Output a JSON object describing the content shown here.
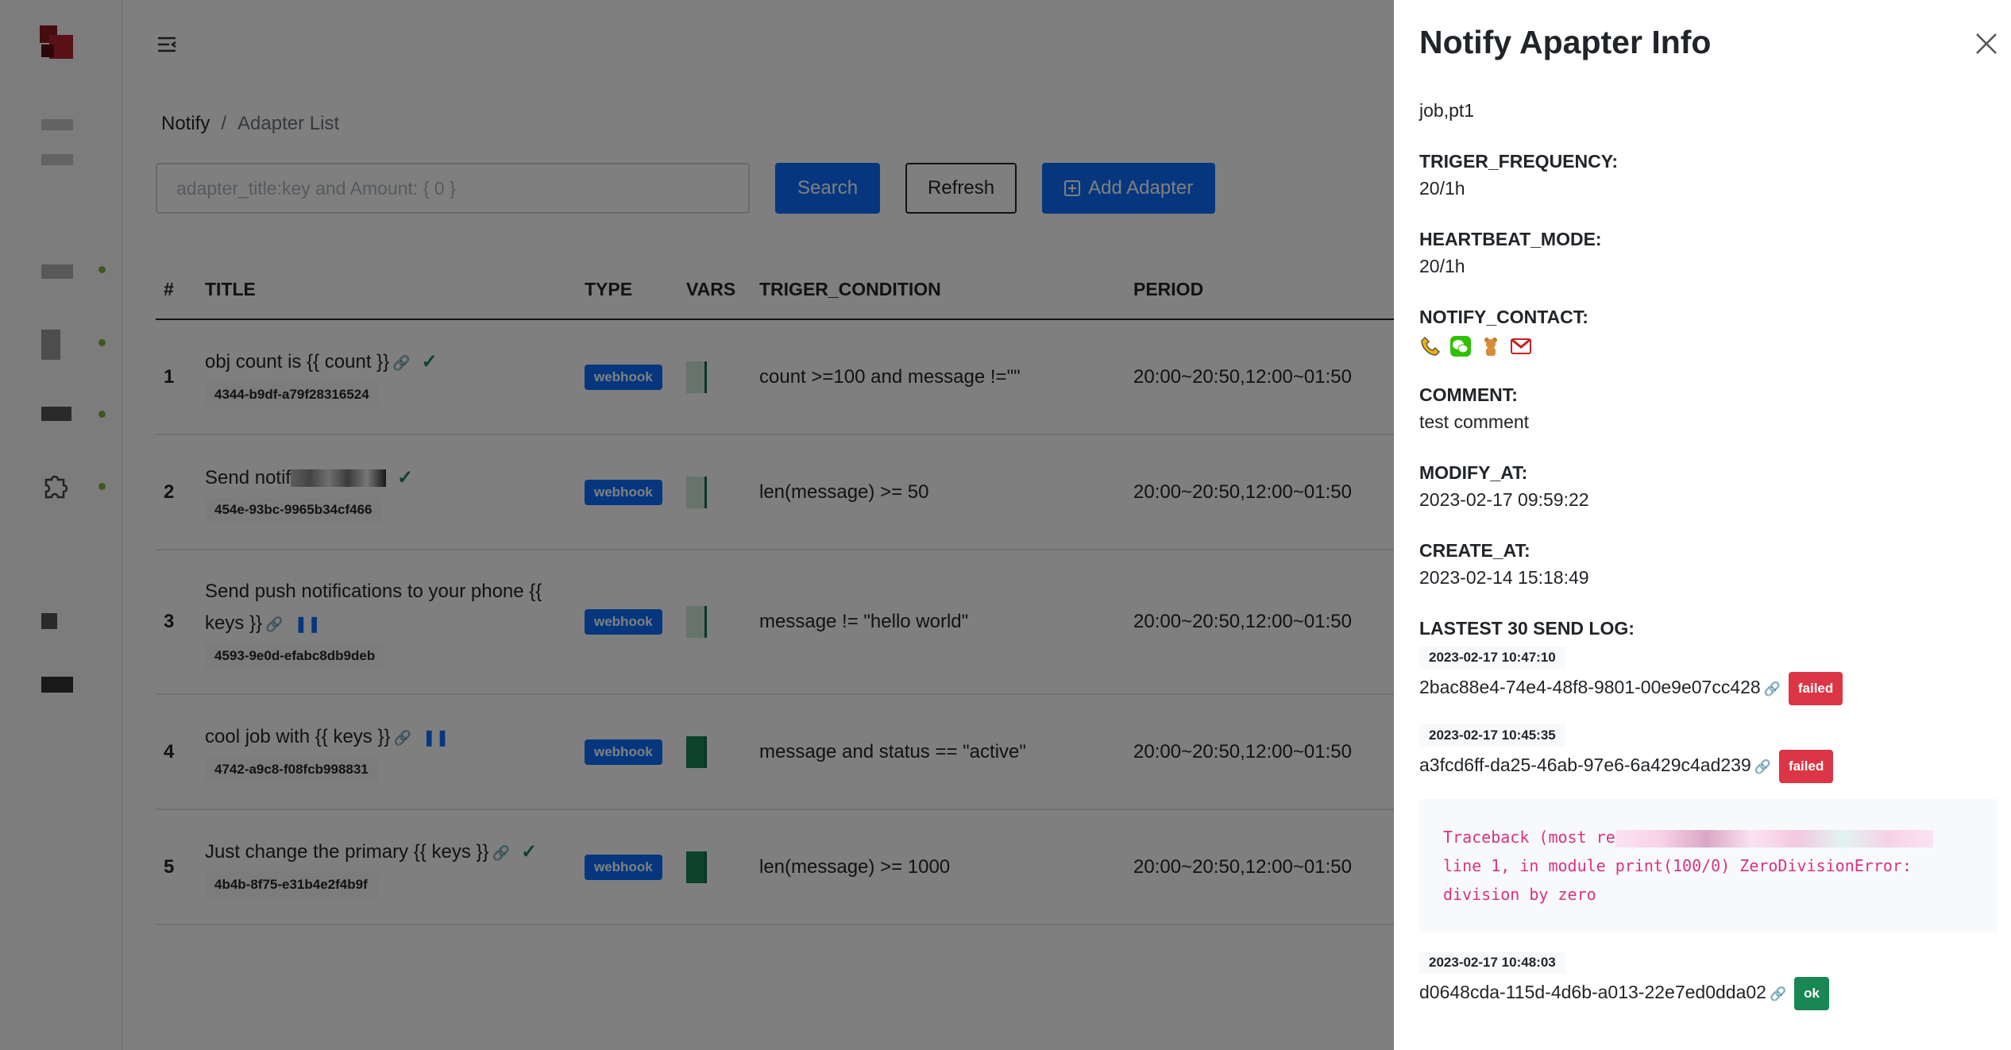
{
  "sidebar": {
    "logo": "app-logo"
  },
  "main": {
    "breadcrumb": {
      "root": "Notify",
      "separator": "/",
      "current": "Adapter List"
    },
    "search": {
      "placeholder": "adapter_title:key and Amount: { 0 }"
    },
    "buttons": {
      "search": "Search",
      "refresh": "Refresh",
      "add": "Add Adapter"
    },
    "table": {
      "headers": [
        "#",
        "TITLE",
        "TYPE",
        "VARS",
        "TRIGER_CONDITION",
        "PERIOD"
      ],
      "rows": [
        {
          "idx": "1",
          "title": "obj count is {{ count }}",
          "uuid": "4344-b9df-a79f28316524",
          "type": "webhook",
          "condition": "count >=100 and message !=\"\"",
          "period": "20:00~20:50,12:00~01:50",
          "status": "check"
        },
        {
          "idx": "2",
          "title": "Send notif",
          "uuid": "454e-93bc-9965b34cf466",
          "type": "webhook",
          "condition": "len(message) >= 50",
          "period": "20:00~20:50,12:00~01:50",
          "status": "check"
        },
        {
          "idx": "3",
          "title": "Send push notifications to your phone {{ keys }}",
          "uuid": "4593-9e0d-efabc8db9deb",
          "type": "webhook",
          "condition": "message != \"hello world\"",
          "period": "20:00~20:50,12:00~01:50",
          "status": "pause"
        },
        {
          "idx": "4",
          "title": "cool job with {{ keys }}",
          "uuid": "4742-a9c8-f08fcb998831",
          "type": "webhook",
          "condition": "message and status == \"active\"",
          "period": "20:00~20:50,12:00~01:50",
          "status": "pause"
        },
        {
          "idx": "5",
          "title": "Just change the primary {{ keys }}",
          "uuid": "4b4b-8f75-e31b4e2f4b9f",
          "type": "webhook",
          "condition": "len(message) >= 1000",
          "period": "20:00~20:50,12:00~01:50",
          "status": "check"
        }
      ]
    }
  },
  "drawer": {
    "title": "Notify Apapter Info",
    "job": "job,pt1",
    "fields": [
      {
        "label": "TRIGER_FREQUENCY:",
        "value": "20/1h"
      },
      {
        "label": "HEARTBEAT_MODE:",
        "value": "20/1h"
      }
    ],
    "contact_label": "NOTIFY_CONTACT:",
    "contacts": [
      "phone-icon",
      "wechat-icon",
      "bear-icon",
      "gmail-icon"
    ],
    "comment_label": "COMMENT:",
    "comment": "test comment",
    "modify_label": "MODIFY_AT:",
    "modify_at": "2023-02-17 09:59:22",
    "create_label": "CREATE_AT:",
    "create_at": "2023-02-14 15:18:49",
    "log_label": "LASTEST 30 SEND LOG:",
    "logs": [
      {
        "time": "2023-02-17 10:47:10",
        "id": "2bac88e4-74e4-48f8-9801-00e9e07cc428",
        "status": "failed"
      },
      {
        "time": "2023-02-17 10:45:35",
        "id": "a3fcd6ff-da25-46ab-97e6-6a429c4ad239",
        "status": "failed"
      },
      {
        "time": "2023-02-17 10:48:03",
        "id": "d0648cda-115d-4d6b-a013-22e7ed0dda02",
        "status": "ok"
      }
    ],
    "traceback": {
      "line1": "Traceback (most re",
      "line2": "line 1, in module print(100/0) ZeroDivisionError:",
      "line3": "division by zero"
    }
  },
  "colors": {
    "primary": "#0d6efd",
    "success": "#198754",
    "danger": "#dc3545",
    "code": "#d63384",
    "brand": "#b3232f"
  }
}
